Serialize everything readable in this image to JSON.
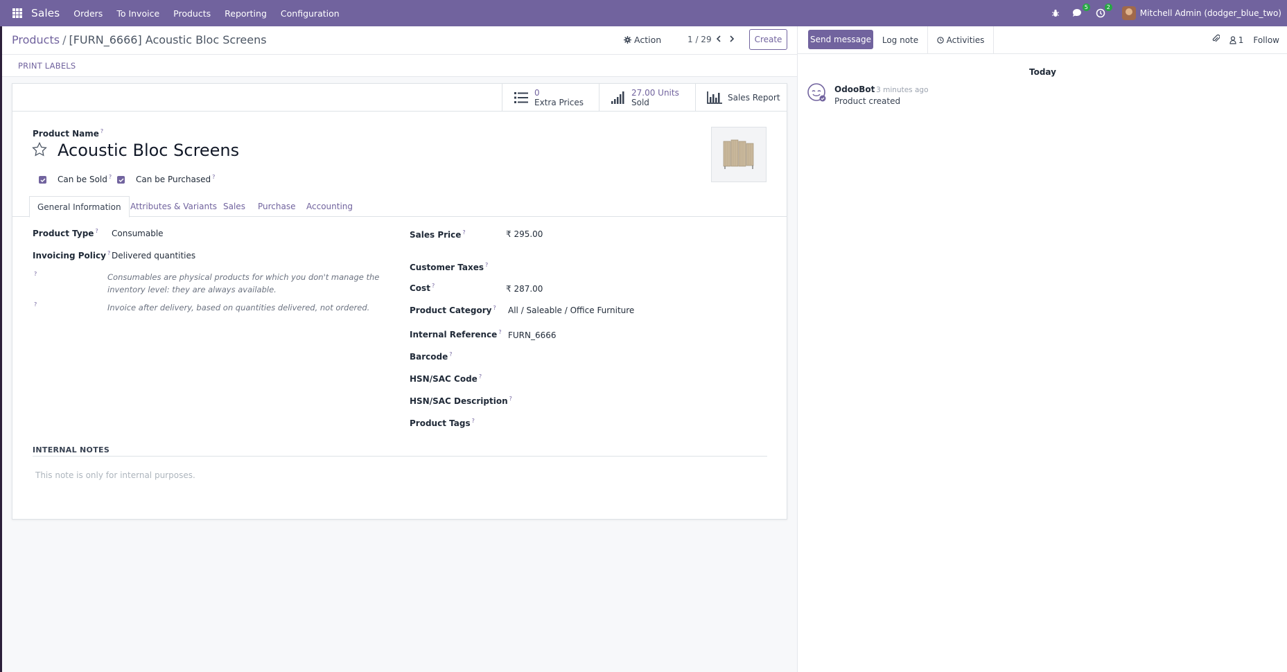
{
  "navbar": {
    "brand": "Sales",
    "menu": [
      "Orders",
      "To Invoice",
      "Products",
      "Reporting",
      "Configuration"
    ],
    "messages_badge": "5",
    "activities_badge": "2",
    "user": "Mitchell Admin (dodger_blue_two)"
  },
  "control": {
    "breadcrumb_parent": "Products",
    "breadcrumb_sep": "/",
    "breadcrumb_current": "[FURN_6666] Acoustic Bloc Screens",
    "action_label": "Action",
    "pager": "1 / 29",
    "create_label": "Create"
  },
  "statusbar": {
    "print_labels": "PRINT LABELS"
  },
  "smart_buttons": {
    "extra_prices_value": "0",
    "extra_prices_label": "Extra Prices",
    "sold_value": "27.00 Units",
    "sold_label": "Sold",
    "sales_report": "Sales Report"
  },
  "form": {
    "product_name_label": "Product Name",
    "product_name": "Acoustic Bloc Screens",
    "can_be_sold": "Can be Sold",
    "can_be_purchased": "Can be Purchased",
    "tabs": [
      "General Information",
      "Attributes & Variants",
      "Sales",
      "Purchase",
      "Accounting"
    ],
    "help_mark": "?",
    "left": {
      "product_type_label": "Product Type",
      "product_type": "Consumable",
      "invoicing_policy_label": "Invoicing Policy",
      "invoicing_policy": "Delivered quantities",
      "help_consumable": "Consumables are physical products for which you don't manage the inventory level: they are always available.",
      "help_invoice": "Invoice after delivery, based on quantities delivered, not ordered."
    },
    "right": {
      "sales_price_label": "Sales Price",
      "sales_price": "₹ 295.00",
      "customer_taxes_label": "Customer Taxes",
      "cost_label": "Cost",
      "cost": "₹ 287.00",
      "category_label": "Product Category",
      "category": "All / Saleable / Office Furniture",
      "internal_ref_label": "Internal Reference",
      "internal_ref": "FURN_6666",
      "barcode_label": "Barcode",
      "hsn_code_label": "HSN/SAC Code",
      "hsn_desc_label": "HSN/SAC Description",
      "tags_label": "Product Tags"
    },
    "notes_title": "INTERNAL NOTES",
    "notes_placeholder": "This note is only for internal purposes."
  },
  "chatter": {
    "send_message": "Send message",
    "log_note": "Log note",
    "activities": "Activities",
    "followers_count": "1",
    "follow": "Follow",
    "today": "Today",
    "message": {
      "author": "OdooBot",
      "time": "- 3 minutes ago",
      "body": "Product created"
    }
  },
  "colors": {
    "brand": "#71639e",
    "badge": "#28a745"
  }
}
